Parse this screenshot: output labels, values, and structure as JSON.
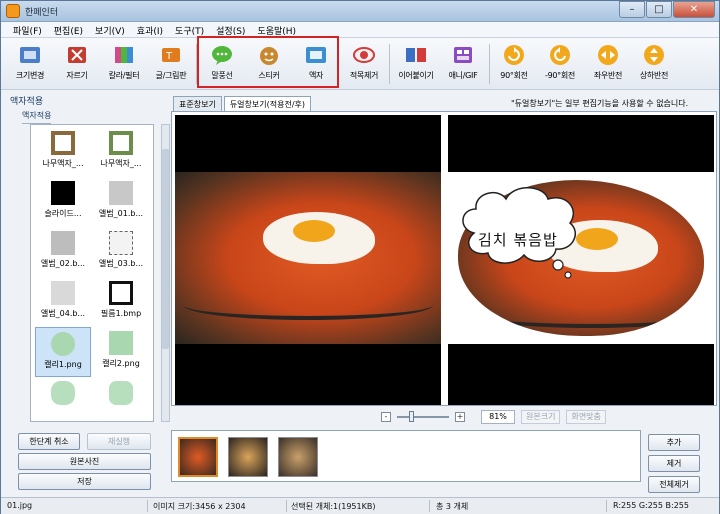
{
  "window": {
    "title": "한페인터",
    "minimize": "–",
    "maximize": "□",
    "close": "✕"
  },
  "menu": [
    "파일(F)",
    "편집(E)",
    "보기(V)",
    "효과(I)",
    "도구(T)",
    "설정(S)",
    "도움말(H)"
  ],
  "toolbar": {
    "resize": "크기변경",
    "crop": "자르기",
    "color_filter": "칼라/필터",
    "text_picture": "글/그림판",
    "speech_bubble": "말풍선",
    "sticker": "스티커",
    "frame": "액자",
    "redeye": "적목제거",
    "join": "이어붙이기",
    "anim_gif": "애니/GIF",
    "rotate_90": "90°회전",
    "rotate_neg90": "-90°회전",
    "flip_h": "좌우반전",
    "flip_v": "상하반전"
  },
  "toolbar_colors": {
    "resize": "#4a7ec9",
    "crop": "#c43b2f",
    "color_filter": "#d34a88",
    "text_picture": "#e07b1e",
    "speech_bubble": "#4fb83a",
    "sticker": "#c9872f",
    "frame": "#3b8ed2",
    "redeye": "#d33a3a",
    "join": "#3a6fc4",
    "anim_gif": "#8a4cc2",
    "rotate": "#f2a81d"
  },
  "side": {
    "title": "액자적용",
    "subtitle": "액자적용",
    "frames": [
      {
        "name": "나무액자_...",
        "color": "#8a6a3a"
      },
      {
        "name": "나무액자_...",
        "color": "#6b8f4a"
      },
      {
        "name": "슬라이드...",
        "color": "#000000"
      },
      {
        "name": "앨범_01.b...",
        "color": "#c8c8c8"
      },
      {
        "name": "앨범_02.b...",
        "color": "#bdbdbd"
      },
      {
        "name": "앨범_03.b...",
        "color": "#e6e6e6"
      },
      {
        "name": "앨범_04.b...",
        "color": "#d9d9d9"
      },
      {
        "name": "필름1.bmp",
        "color": "#111111"
      },
      {
        "name": "캘리1.png",
        "color": "#a9d8b0"
      },
      {
        "name": "캘리2.png",
        "color": "#a9d8b0"
      },
      {
        "name": "",
        "color": "#b7dfbd"
      },
      {
        "name": "",
        "color": "#b7dfbd"
      }
    ]
  },
  "tabs": [
    "표준창보기",
    "듀얼창보기(적용전/후)"
  ],
  "tab_note": "\"듀얼창보기\"는 일부 편집기능을 사용할 수 없습니다.",
  "preview": {
    "bubble_text": "김치 볶음밥"
  },
  "zoom": {
    "minus": "-",
    "plus": "+",
    "value": "81%",
    "original_size": "원본크기",
    "fit_screen": "화면맞춤"
  },
  "left_buttons": {
    "undo": "한단계 취소",
    "redo": "재실행",
    "original": "원본사진",
    "save": "저장"
  },
  "right_buttons": {
    "add": "추가",
    "remove": "제거",
    "remove_all": "전체제거"
  },
  "status": {
    "file": "01.jpg",
    "image_size": "이미지 크기:3456 x 2304",
    "selected": "선택된 개체:1(1951KB)",
    "total": "총 3 개체",
    "rgb": "R:255 G:255 B:255"
  }
}
